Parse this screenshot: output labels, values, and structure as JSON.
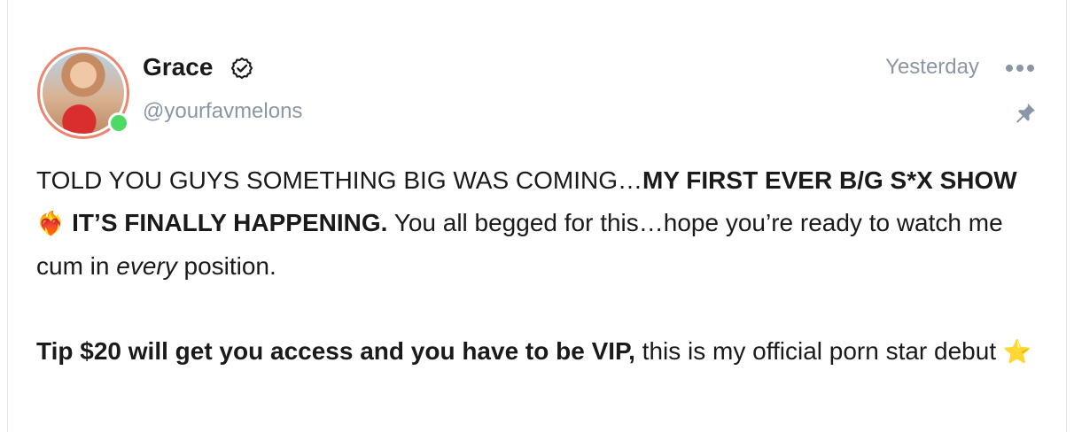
{
  "post": {
    "author": {
      "name": "Grace",
      "handle": "@yourfavmelons",
      "verified_icon": "verified-badge-icon",
      "online": true
    },
    "timestamp": "Yesterday",
    "more_icon": "more-dots-icon",
    "pin_icon": "pin-icon",
    "paragraph1": {
      "part1": "TOLD YOU GUYS SOMETHING BIG WAS COMING…",
      "bold1": "MY FIRST EVER B/G S*X SHOW",
      "emoji1": "❤️‍🔥",
      "bold2": "IT’S FINALLY HAPPENING.",
      "part2": " You all begged for this…hope you’re ready to watch me cum in ",
      "italic": "every",
      "part3": " position."
    },
    "paragraph2": {
      "bold": "Tip $20 will get you access and you have to be VIP,",
      "text": " this is my official porn star debut ",
      "emoji": "⭐"
    }
  },
  "colors": {
    "online": "#4cd964",
    "muted": "#8a96a3",
    "avatar_ring": "#e9876f"
  }
}
